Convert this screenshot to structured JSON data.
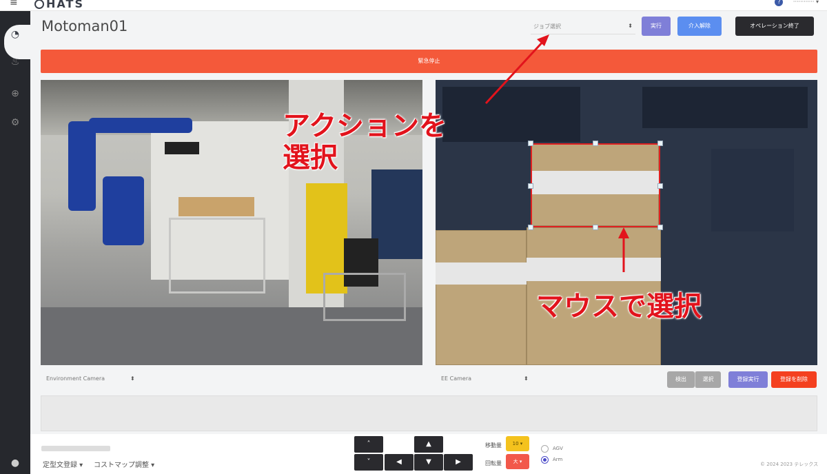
{
  "app": {
    "logo": "HATS",
    "user": "············ ▾",
    "help": "?"
  },
  "header": {
    "title": "Motoman01",
    "job_select": "ジョブ選択",
    "run": "実行",
    "intervene_release": "介入解除",
    "end_operation": "オペレーション終了"
  },
  "emergency_stop": "緊急停止",
  "cameras": {
    "left_select": "Environment Camera",
    "right_select": "EE Camera"
  },
  "camera_buttons": {
    "grey1": "検出",
    "grey2": "選択",
    "save": "登録実行",
    "delete": "登録を削除"
  },
  "annotations": {
    "select_action": "アクションを\n選択",
    "select_mouse": "マウスで選択",
    "arrow_color": "#e2131c"
  },
  "bottom": {
    "link1": "定型文登録 ▾",
    "link2": "コストマップ調整 ▾",
    "up": "˄",
    "down": "˅",
    "forward": "▲",
    "left": "◀",
    "back": "▼",
    "right": "▶",
    "move_label": "移動量",
    "rotate_label": "回転量",
    "move_amount": "10 ▾",
    "rotate_amount": "大 ▾",
    "radio_agv": "AGV",
    "radio_arm": "Arm",
    "copyright": "© 2024 2023 テレックス"
  },
  "icons": {
    "sidebar": [
      "dashboard-icon",
      "flame-icon",
      "globe-icon",
      "gear-icon"
    ],
    "bottom": "power-icon"
  },
  "colors": {
    "emergency": "#f4593a",
    "run": "#7f7fd8",
    "intervene": "#5b8ef0",
    "delete": "#f4401f",
    "move_amount": "#f4c21d",
    "rotate_amount": "#f2584a"
  }
}
